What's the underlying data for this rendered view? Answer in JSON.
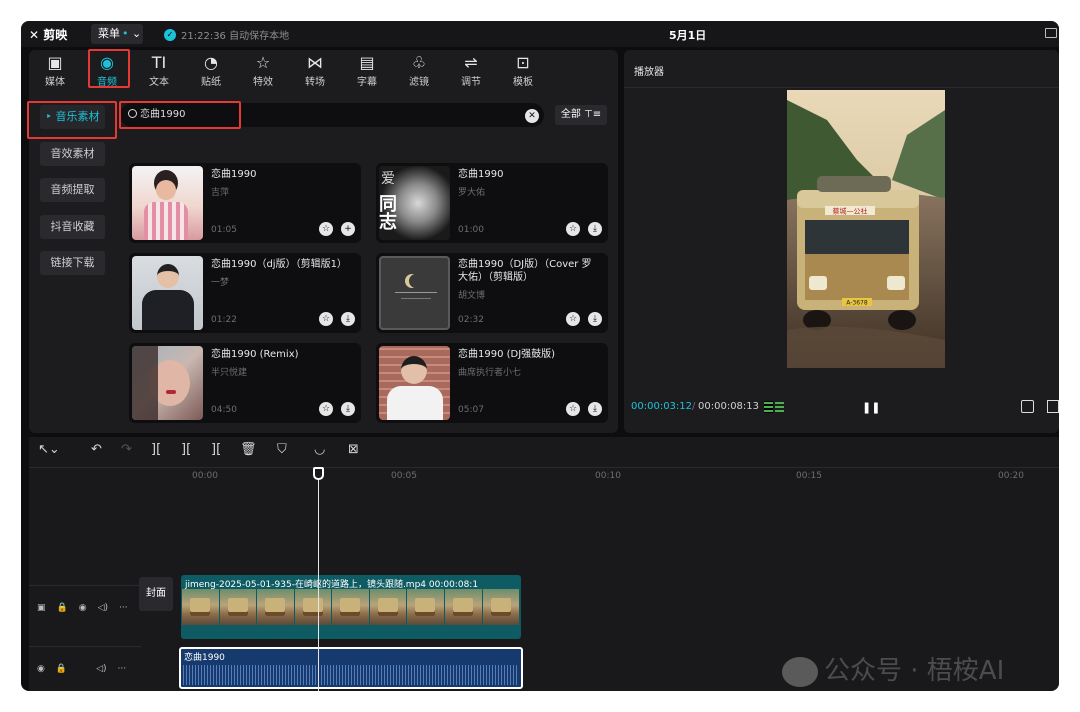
{
  "titlebar": {
    "app_name": "剪映",
    "menu_label": "菜单",
    "save_status": "21:22:36 自动保存本地",
    "title": "5月1日"
  },
  "toolbar": {
    "tools": [
      {
        "label": "媒体",
        "icon": "media-icon"
      },
      {
        "label": "音频",
        "icon": "audio-icon"
      },
      {
        "label": "文本",
        "icon": "text-icon"
      },
      {
        "label": "贴纸",
        "icon": "sticker-icon"
      },
      {
        "label": "特效",
        "icon": "effects-icon"
      },
      {
        "label": "转场",
        "icon": "transition-icon"
      },
      {
        "label": "字幕",
        "icon": "subtitle-icon"
      },
      {
        "label": "滤镜",
        "icon": "filter-icon"
      },
      {
        "label": "调节",
        "icon": "adjust-icon"
      },
      {
        "label": "模板",
        "icon": "template-icon"
      }
    ],
    "active": "音频"
  },
  "sidebar": {
    "items": [
      {
        "label": "音乐素材",
        "active": true
      },
      {
        "label": "音效素材"
      },
      {
        "label": "音频提取"
      },
      {
        "label": "抖音收藏"
      },
      {
        "label": "链接下载"
      }
    ]
  },
  "search": {
    "value": "恋曲1990",
    "filter_label": "全部"
  },
  "results": [
    {
      "title": "恋曲1990",
      "artist": "吉萍",
      "duration": "01:05",
      "action": "add"
    },
    {
      "title": "恋曲1990",
      "artist": "罗大佑",
      "duration": "01:00",
      "action": "download"
    },
    {
      "title": "恋曲1990（dj版）（剪辑版1）",
      "artist": "一梦",
      "duration": "01:22",
      "action": "download"
    },
    {
      "title": "恋曲1990（DJ版）（Cover 罗大佑）（剪辑版）",
      "artist": "胡文博",
      "duration": "02:32",
      "action": "download"
    },
    {
      "title": "恋曲1990 (Remix)",
      "artist": "半只悦建",
      "duration": "04:50",
      "action": "download"
    },
    {
      "title": "恋曲1990 (DJ强鼓版)",
      "artist": "曲席执行者小七",
      "duration": "05:07",
      "action": "download"
    }
  ],
  "player": {
    "title": "播放器",
    "current_time": "00:00:03:12",
    "separator": "/",
    "total_time": "00:00:08:13",
    "bus_sign": "蔡城—公社",
    "plate": "A-3678"
  },
  "timeline": {
    "ticks": [
      "00:00",
      "00:05",
      "00:10",
      "00:15",
      "00:20"
    ],
    "cover_label": "封面",
    "video_clip_label": "jimeng-2025-05-01-935-在崎岖的道路上，镜头跟随.mp4  00:00:08:1",
    "audio_clip_label": "恋曲1990"
  },
  "watermark": "公众号 · 梧桉AI",
  "colors": {
    "accent": "#1bc3d9",
    "highlight_box": "#e53935",
    "panel": "#1c1c1f",
    "background": "#0d0d0f",
    "video_clip": "#0e5b63",
    "audio_clip": "#173a6e"
  }
}
